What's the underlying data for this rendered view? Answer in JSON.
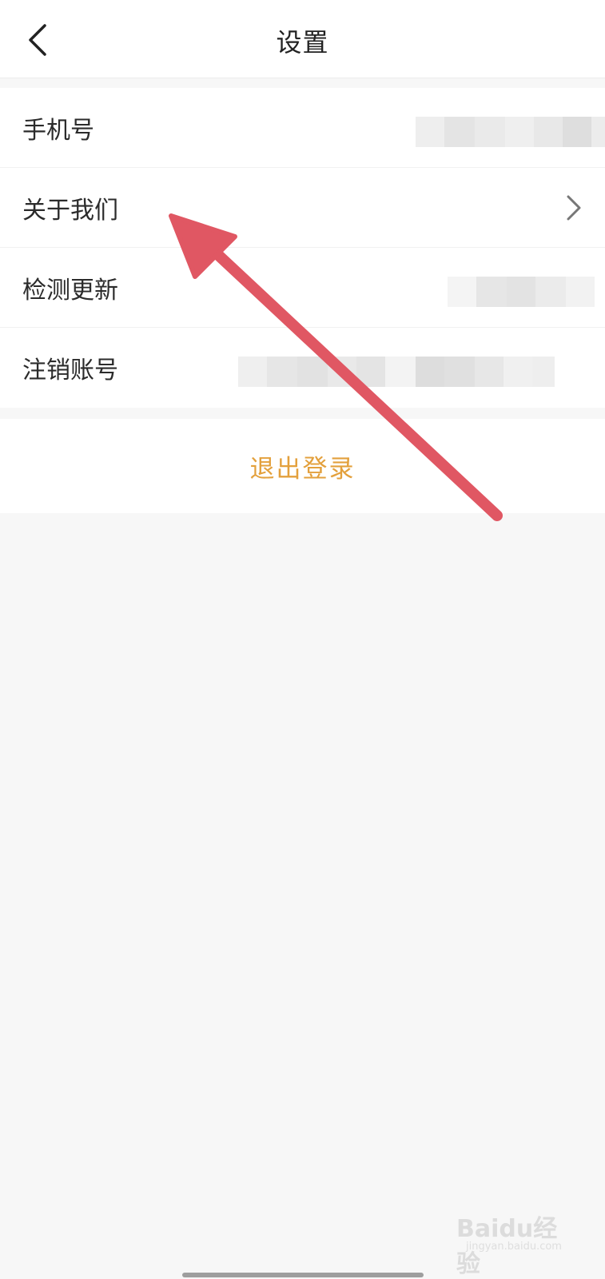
{
  "nav": {
    "title": "设置",
    "back_icon": "chevron-left-icon"
  },
  "settings": {
    "items": [
      {
        "label": "手机号"
      },
      {
        "label": "关于我们",
        "icon": "chevron-right-icon"
      },
      {
        "label": "检测更新"
      },
      {
        "label": "注销账号"
      }
    ]
  },
  "logout": {
    "label": "退出登录"
  },
  "watermark": {
    "main": "Baidu经验",
    "sub": "jingyan.baidu.com"
  },
  "colors": {
    "accent": "#e3a03c",
    "annotation_arrow": "#e05763",
    "background": "#f7f7f7"
  }
}
